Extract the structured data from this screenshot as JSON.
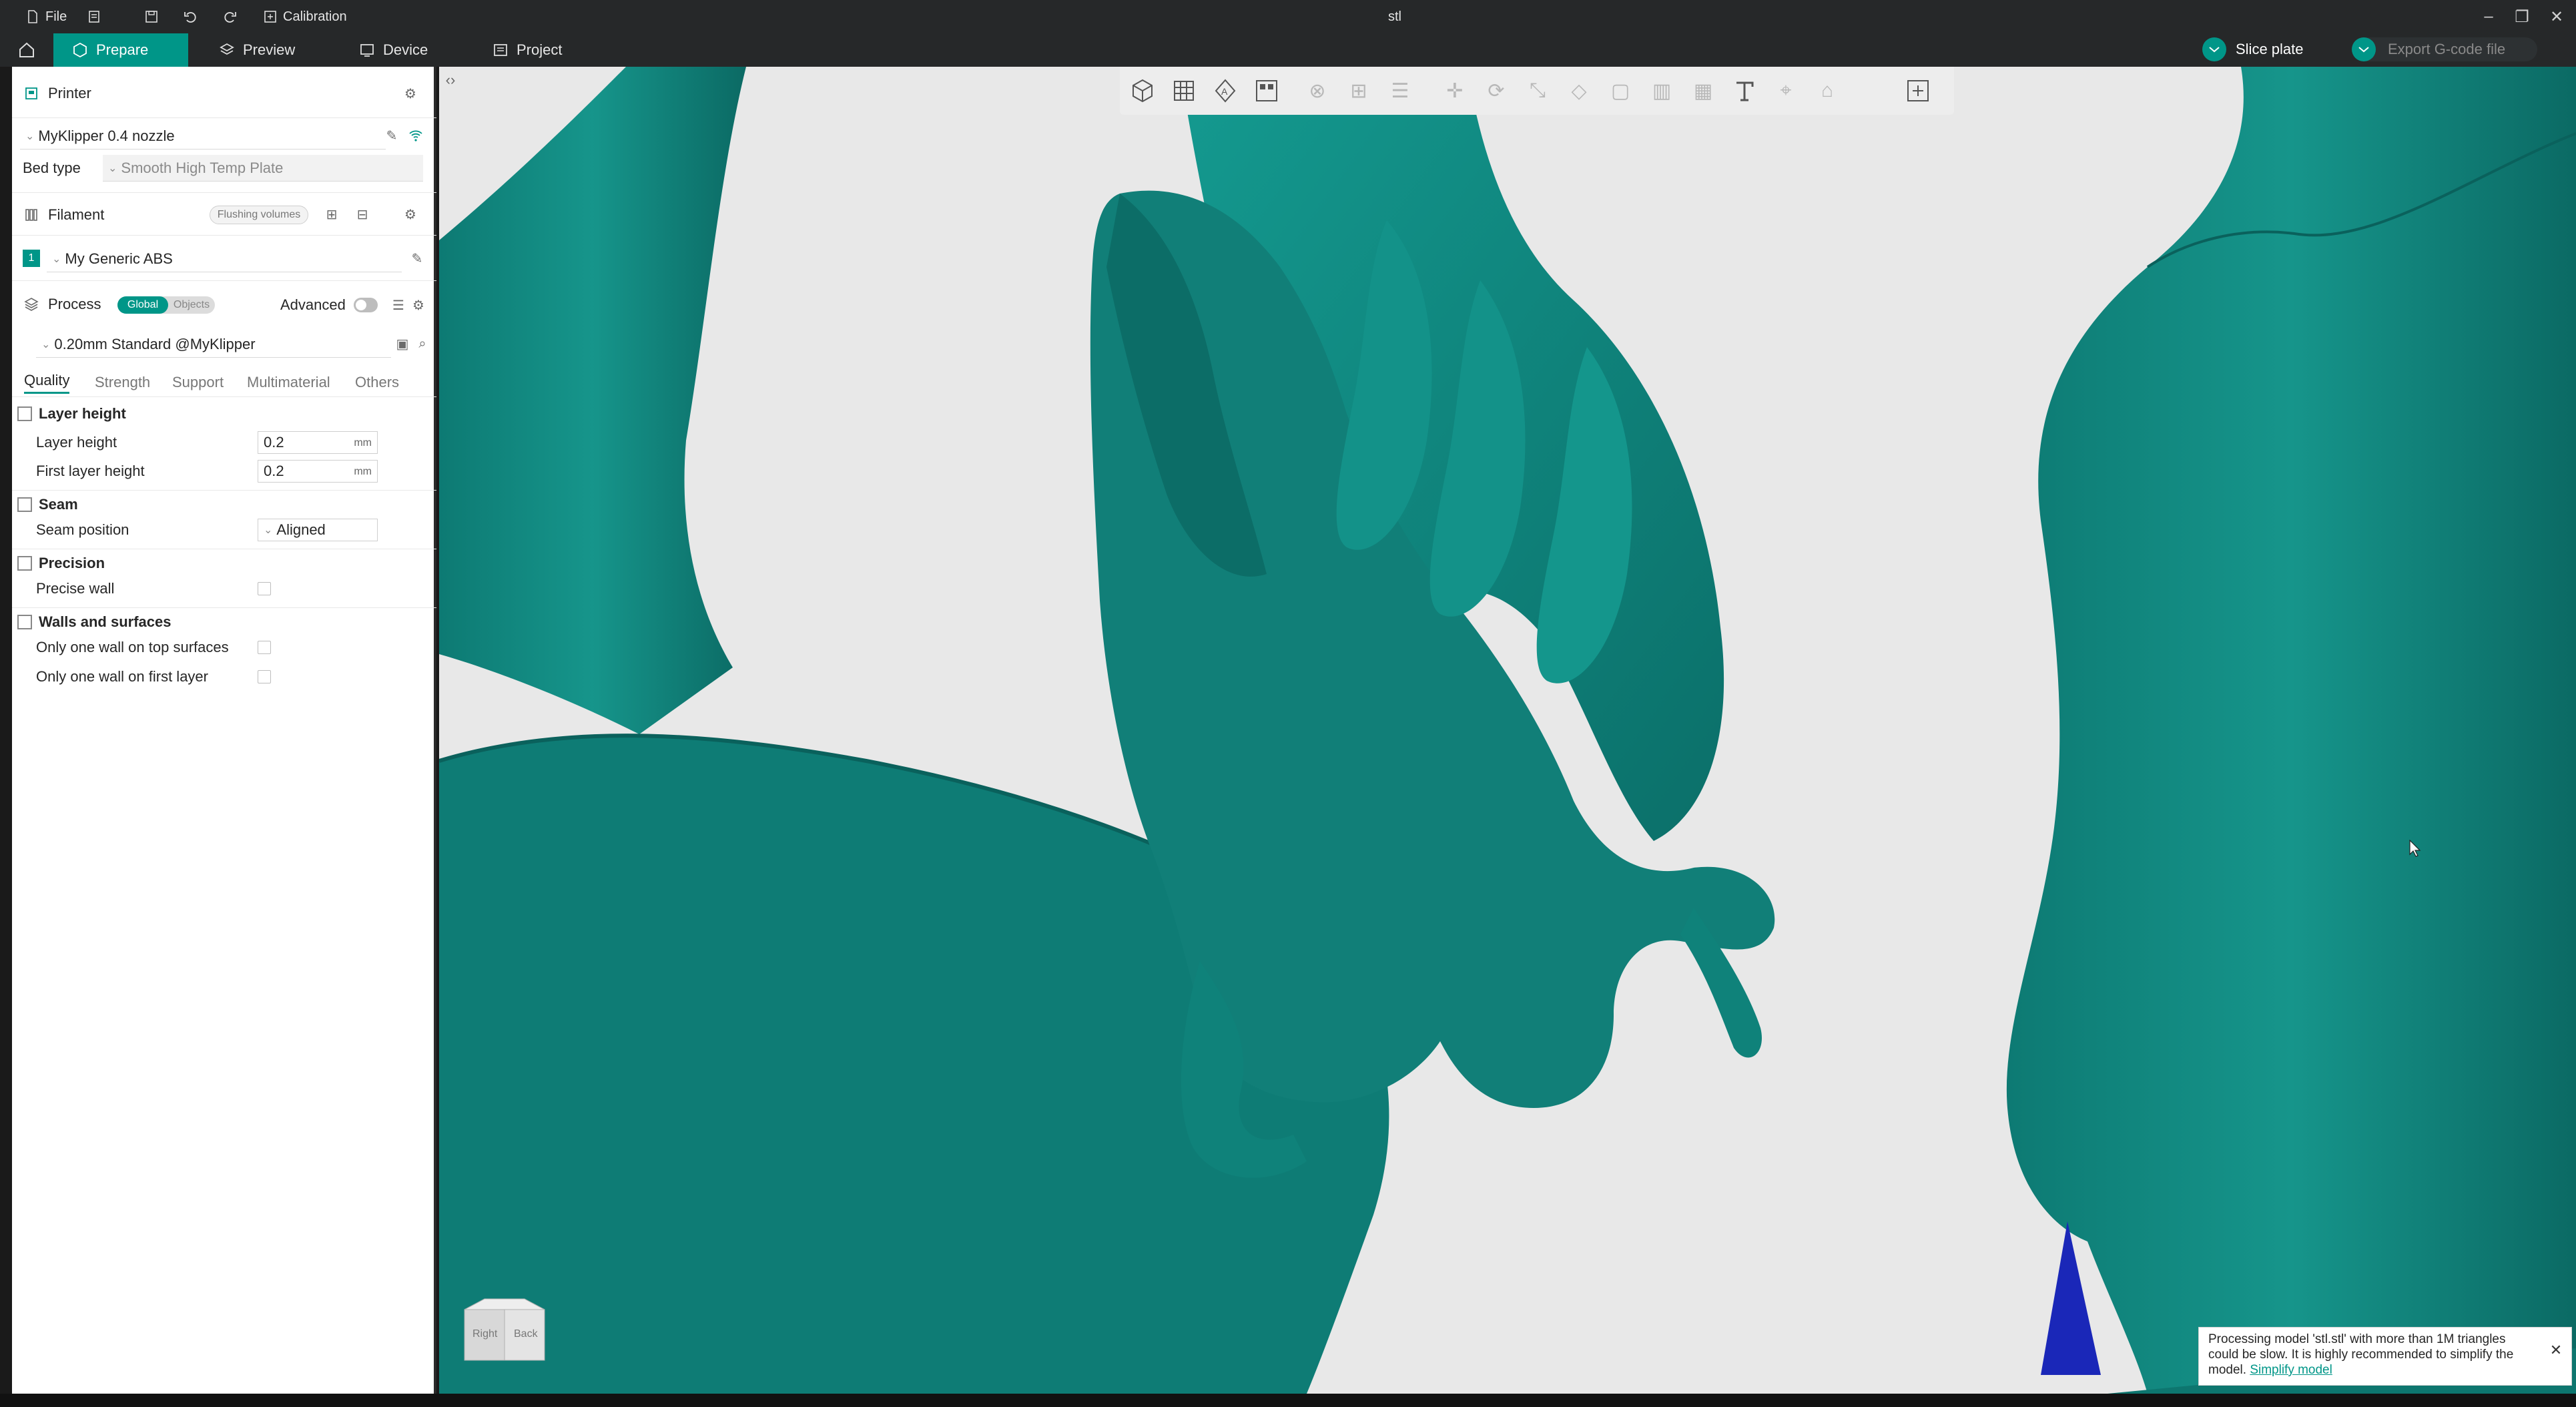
{
  "titlebar": {
    "file_label": "File",
    "calibration_label": "Calibration",
    "window_title": "stl"
  },
  "tabs": [
    {
      "label": "Prepare",
      "active": true
    },
    {
      "label": "Preview",
      "active": false
    },
    {
      "label": "Device",
      "active": false
    },
    {
      "label": "Project",
      "active": false
    }
  ],
  "actions": {
    "slice_label": "Slice plate",
    "export_label": "Export G-code file"
  },
  "printer": {
    "section_title": "Printer",
    "printer_name": "MyKlipper 0.4 nozzle",
    "bed_type_label": "Bed type",
    "bed_type_value": "Smooth High Temp Plate"
  },
  "filament": {
    "section_title": "Filament",
    "flushing_label": "Flushing volumes",
    "slot_number": "1",
    "filament_name": "My Generic ABS"
  },
  "process": {
    "section_title": "Process",
    "global_label": "Global",
    "objects_label": "Objects",
    "advanced_label": "Advanced",
    "profile_name": "0.20mm Standard @MyKlipper",
    "subtabs": [
      "Quality",
      "Strength",
      "Support",
      "Multimaterial",
      "Others"
    ],
    "active_subtab": "Quality"
  },
  "quality": {
    "layer_height_group": "Layer height",
    "layer_height_label": "Layer height",
    "layer_height_value": "0.2",
    "first_layer_label": "First layer height",
    "first_layer_value": "0.2",
    "unit": "mm",
    "seam_group": "Seam",
    "seam_position_label": "Seam position",
    "seam_position_value": "Aligned",
    "precision_group": "Precision",
    "precise_wall_label": "Precise wall",
    "walls_group": "Walls and surfaces",
    "one_wall_top_label": "Only one wall on top surfaces",
    "one_wall_first_label": "Only one wall on first layer"
  },
  "viewcube": {
    "right_label": "Right",
    "back_label": "Back"
  },
  "notification": {
    "message": "Processing model 'stl.stl' with more than 1M triangles could be slow. It is highly recommended to simplify the model.",
    "link_label": "Simplify model"
  },
  "colors": {
    "accent": "#009688",
    "model": "#11817a",
    "chrome": "#262829",
    "viewport_bg": "#e8e8e8"
  }
}
